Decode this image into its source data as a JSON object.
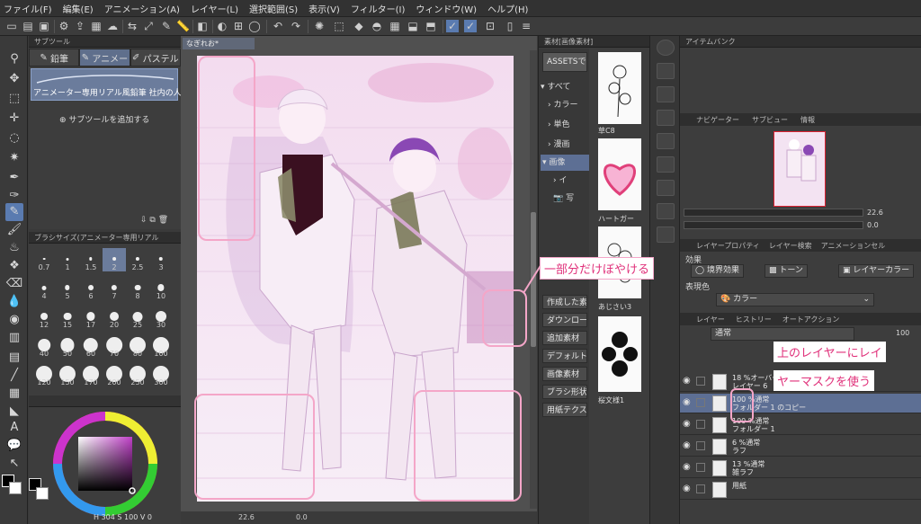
{
  "menu": [
    "ファイル(F)",
    "編集(E)",
    "アニメーション(A)",
    "レイヤー(L)",
    "選択範囲(S)",
    "表示(V)",
    "フィルター(I)",
    "ウィンドウ(W)",
    "ヘルプ(H)"
  ],
  "subtool": {
    "header": "サブツール",
    "tabs": [
      "鉛筆",
      "アニメー",
      "パステル"
    ],
    "brush_name": "アニメーター専用リアル風鉛筆 社内の人",
    "add_label": "サブツールを追加する"
  },
  "brush_size": {
    "header": "ブラシサイズ(アニメーター専用リアル",
    "sizes": [
      "0.7",
      "1",
      "1.5",
      "2",
      "2.5",
      "3",
      "4",
      "5",
      "6",
      "7",
      "8",
      "10",
      "12",
      "15",
      "17",
      "20",
      "25",
      "30",
      "40",
      "50",
      "60",
      "70",
      "80",
      "100",
      "120",
      "150",
      "170",
      "200",
      "250",
      "300"
    ],
    "selected": "2"
  },
  "color": {
    "status_h": "H",
    "status_h_val": "304",
    "status_s": "S",
    "status_s_val": "100",
    "status_v": "V",
    "status_v_val": "0",
    "primary": "#000000",
    "secondary": "#ffffff",
    "picker_hue": "#c040c8"
  },
  "canvas": {
    "tab": "なぎれお*",
    "zoom": "22.6",
    "rotation": "0.0"
  },
  "material": {
    "header": "素材[画像素材]",
    "assets_label": "ASSETSで",
    "tree": [
      "すべて",
      "カラー",
      "単色",
      "漫画",
      "画像",
      "イ",
      "写"
    ],
    "buttons": [
      "作成した素",
      "ダウンロード",
      "追加素材",
      "デフォルト",
      "画像素材",
      "ブラシ形状",
      "用紙テクスチ"
    ],
    "thumbs": [
      "草C8",
      "ハートガー",
      "あじさい3",
      "桜文様1"
    ]
  },
  "item_bank": {
    "header": "アイテムバンク"
  },
  "navigator": {
    "tabs": [
      "ナビゲーター",
      "サブビュー",
      "情報"
    ],
    "zoom": "22.6",
    "rotation": "0.0"
  },
  "layer_property": {
    "tabs": [
      "レイヤープロパティ",
      "レイヤー検索",
      "アニメーションセル"
    ],
    "effect_label": "効果",
    "effects": [
      "境界効果",
      "トーン",
      "レイヤーカラー"
    ],
    "expression_label": "表現色",
    "expression_value": "カラー"
  },
  "layers": {
    "tabs": [
      "レイヤー",
      "ヒストリー",
      "オートアクション"
    ],
    "blend_mode": "通常",
    "opacity": "100",
    "rows": [
      {
        "line1": "18 %オーバーレ",
        "line2": "レイヤー 6",
        "selected": false
      },
      {
        "line1": "100 %通常",
        "line2": "フォルダー 1 のコピー",
        "selected": true
      },
      {
        "line1": "100 %通常",
        "line2": "フォルダー 1",
        "selected": false
      },
      {
        "line1": "6 %通常",
        "line2": "ラフ",
        "selected": false
      },
      {
        "line1": "13 %通常",
        "line2": "雑ラフ",
        "selected": false
      },
      {
        "line1": "用紙",
        "line2": "",
        "selected": false
      }
    ]
  },
  "annotations": {
    "blur": "一部分だけぼやける",
    "mask_line1": "上のレイヤーにレイ",
    "mask_line2": "ヤーマスクを使う"
  }
}
